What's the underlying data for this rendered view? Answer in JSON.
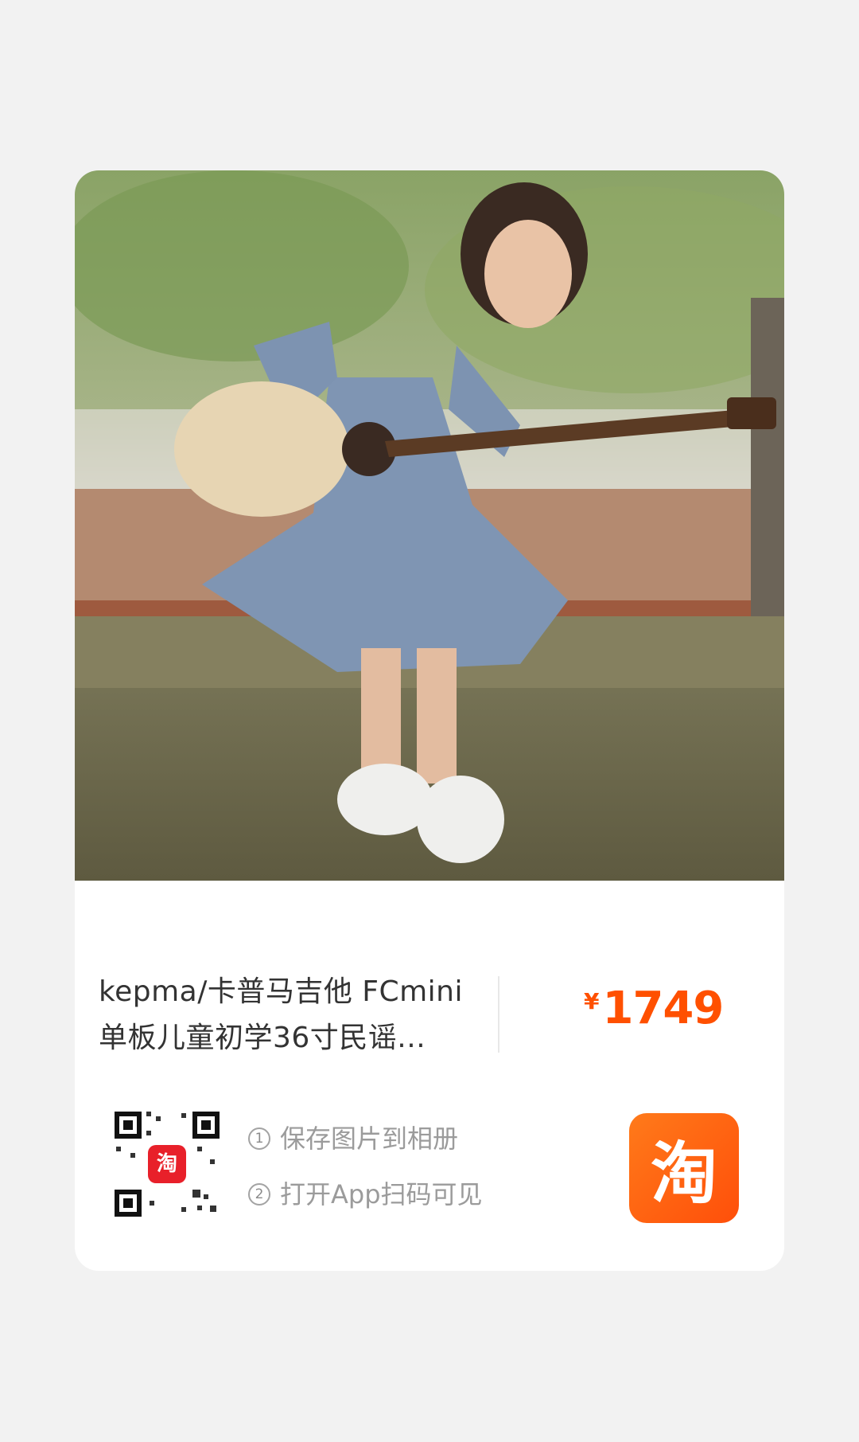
{
  "product": {
    "title_line1": "kepma/卡普马吉他 FCmini",
    "title_line2": "单板儿童初学36寸民谣...",
    "currency_symbol": "¥",
    "price": "1749"
  },
  "share": {
    "qr_badge_text": "淘",
    "steps": [
      {
        "num": "1",
        "text": "保存图片到相册"
      },
      {
        "num": "2",
        "text": "打开App扫码可见"
      }
    ],
    "app_logo_text": "淘"
  },
  "colors": {
    "accent": "#ff5000",
    "background": "#f2f2f2",
    "card": "#ffffff"
  },
  "icons": {
    "qr": "qr-code-icon",
    "app": "taobao-logo-icon"
  }
}
